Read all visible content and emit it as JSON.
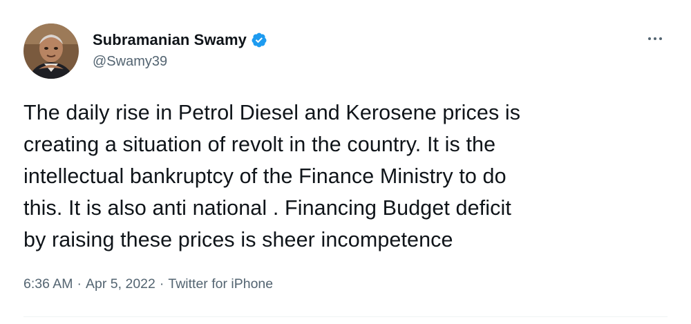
{
  "tweet": {
    "author": {
      "display_name": "Subramanian Swamy",
      "handle": "@Swamy39",
      "verified": true
    },
    "text": "The daily rise in Petrol Diesel and Kerosene prices is\ncreating a situation of revolt in the country. It is the\nintellectual bankruptcy of the Finance Ministry to do\nthis. It is also anti national . Financing Budget deficit\nby raising these prices is sheer incompetence",
    "time": "6:36 AM",
    "date": "Apr 5, 2022",
    "source": "Twitter for iPhone",
    "separator": "·"
  },
  "icons": {
    "verified": "verified-badge-icon",
    "more": "more-options-icon"
  },
  "colors": {
    "text_primary": "#0f1419",
    "text_secondary": "#536471",
    "verified_blue": "#1d9bf0"
  }
}
